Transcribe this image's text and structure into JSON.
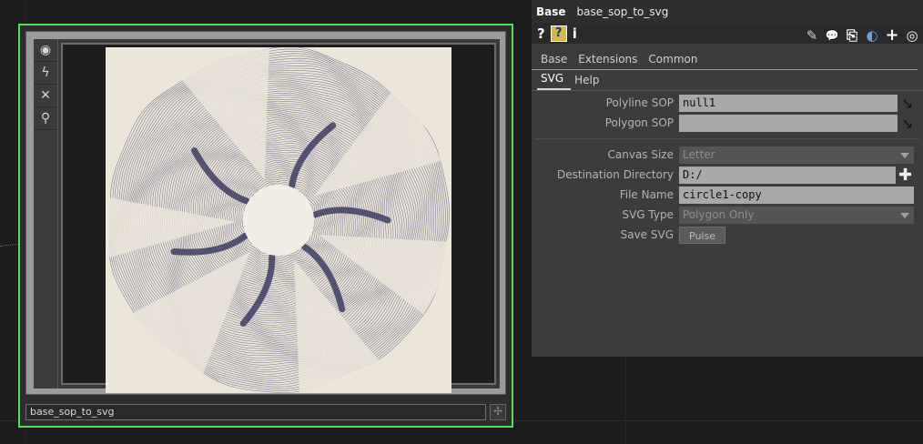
{
  "node": {
    "name": "base_sop_to_svg",
    "side_tools": [
      {
        "icon": "target-icon",
        "glyph": "◉"
      },
      {
        "icon": "lightning-icon",
        "glyph": "ϟ"
      },
      {
        "icon": "close-icon",
        "glyph": "✕"
      },
      {
        "icon": "pin-icon",
        "glyph": "⚲"
      }
    ],
    "corner_glyph": "✢"
  },
  "panel": {
    "op_type": "Base",
    "op_name": "base_sop_to_svg",
    "icons_left": [
      {
        "icon": "help-icon",
        "glyph": "?"
      },
      {
        "icon": "help-python-icon",
        "glyph": "?"
      },
      {
        "icon": "info-icon",
        "glyph": "i"
      }
    ],
    "icons_right": [
      {
        "icon": "pencil-icon",
        "glyph": "✎"
      },
      {
        "icon": "comment-icon",
        "glyph": "💬"
      },
      {
        "icon": "clone-icon",
        "glyph": "⎘"
      },
      {
        "icon": "python-icon",
        "glyph": "◐"
      },
      {
        "icon": "add-icon",
        "glyph": "+"
      },
      {
        "icon": "target-icon",
        "glyph": "◎"
      }
    ],
    "page_tabs": [
      "Base",
      "Extensions",
      "Common"
    ],
    "custom_tabs": [
      "SVG",
      "Help"
    ],
    "active_custom_tab": "SVG",
    "params": {
      "polyline_sop": {
        "label": "Polyline SOP",
        "value": "null1"
      },
      "polygon_sop": {
        "label": "Polygon SOP",
        "value": ""
      },
      "canvas_size": {
        "label": "Canvas Size",
        "value": "Letter"
      },
      "dest_dir": {
        "label": "Destination Directory",
        "value": "D:/"
      },
      "file_name": {
        "label": "File Name",
        "value": "circle1-copy"
      },
      "svg_type": {
        "label": "SVG Type",
        "value": "Polygon Only"
      },
      "save_svg": {
        "label": "Save SVG",
        "button": "Pulse"
      }
    }
  },
  "colors": {
    "node_selected_border": "#4ee04e",
    "preview_ink": "#2b2a55",
    "preview_paper": "#ebe5da"
  }
}
